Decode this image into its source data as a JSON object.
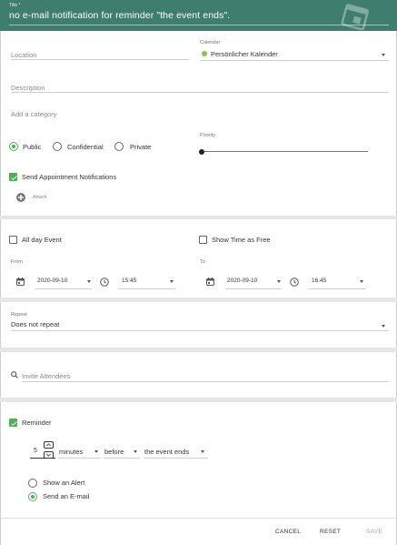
{
  "header": {
    "title_label": "Title *",
    "title_value": "no e-mail notification for reminder \"the event ends\"."
  },
  "details": {
    "location_placeholder": "Location",
    "calendar_label": "Calendar",
    "calendar_value": "Persönlicher Kalender",
    "calendar_color": "#8bc34a",
    "description_placeholder": "Description",
    "category_placeholder": "Add a category",
    "privacy_options": [
      "Public",
      "Confidential",
      "Private"
    ],
    "privacy_selected": "Public",
    "priority_label": "Priority",
    "priority_level": 0,
    "send_notifications_label": "Send Appointment Notifications",
    "send_notifications_checked": true,
    "attach_label": "Attach"
  },
  "timing": {
    "all_day_label": "All day Event",
    "show_free_label": "Show Time as Free",
    "from_label": "From",
    "from_date": "2020-09-10",
    "from_time": "15:45",
    "to_label": "To",
    "to_date": "2020-09-10",
    "to_time": "16:45"
  },
  "repeat": {
    "label": "Repeat",
    "value": "Does not repeat"
  },
  "attendees": {
    "placeholder": "Invite Attendees"
  },
  "reminder": {
    "label": "Reminder",
    "checked": true,
    "amount": "5",
    "unit": "minutes",
    "relation": "before",
    "anchor": "the event ends",
    "alert_label": "Show an Alert",
    "email_label": "Send an E-mail",
    "selected": "email"
  },
  "footer": {
    "cancel": "CANCEL",
    "reset": "RESET",
    "save": "SAVE"
  },
  "colors": {
    "header_bg": "#3f7d6e",
    "accent": "#4caf50"
  }
}
